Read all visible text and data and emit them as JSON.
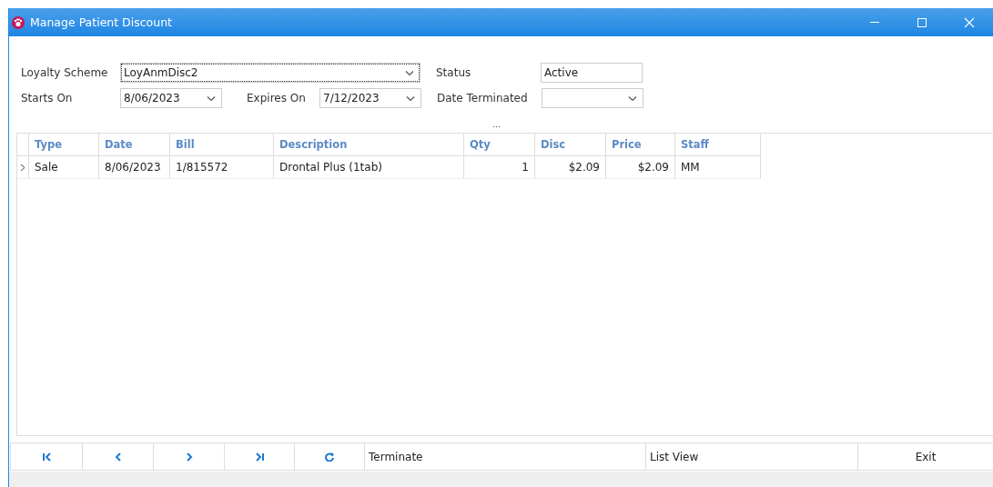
{
  "window": {
    "title": "Manage Patient Discount"
  },
  "form": {
    "loyalty_scheme": {
      "label": "Loyalty Scheme",
      "value": "LoyAnmDisc2",
      "focused": true
    },
    "status": {
      "label": "Status",
      "value": "Active"
    },
    "starts_on": {
      "label": "Starts On",
      "value": "8/06/2023"
    },
    "expires_on": {
      "label": "Expires On",
      "value": "7/12/2023"
    },
    "date_terminated": {
      "label": "Date Terminated"
    }
  },
  "grid_handle": "...",
  "table": {
    "columns": [
      {
        "label": "Type"
      },
      {
        "label": "Date"
      },
      {
        "label": "Bill"
      },
      {
        "label": "Description"
      },
      {
        "label": "Qty"
      },
      {
        "label": "Disc"
      },
      {
        "label": "Price"
      },
      {
        "label": "Staff"
      }
    ],
    "rows": [
      {
        "current": true,
        "cells": [
          "Sale",
          "8/06/2023",
          "1/815572",
          "Drontal Plus (1tab)",
          "1",
          "$2.09",
          "$2.09",
          "MM"
        ]
      }
    ]
  },
  "toolbar": [
    {
      "kind": "first"
    },
    {
      "kind": "prev"
    },
    {
      "kind": "next"
    },
    {
      "kind": "last"
    },
    {
      "kind": "refresh"
    },
    {
      "kind": "text",
      "label": "Terminate"
    },
    {
      "kind": "text",
      "label": "List View"
    },
    {
      "kind": "centered",
      "label": "Exit"
    }
  ]
}
